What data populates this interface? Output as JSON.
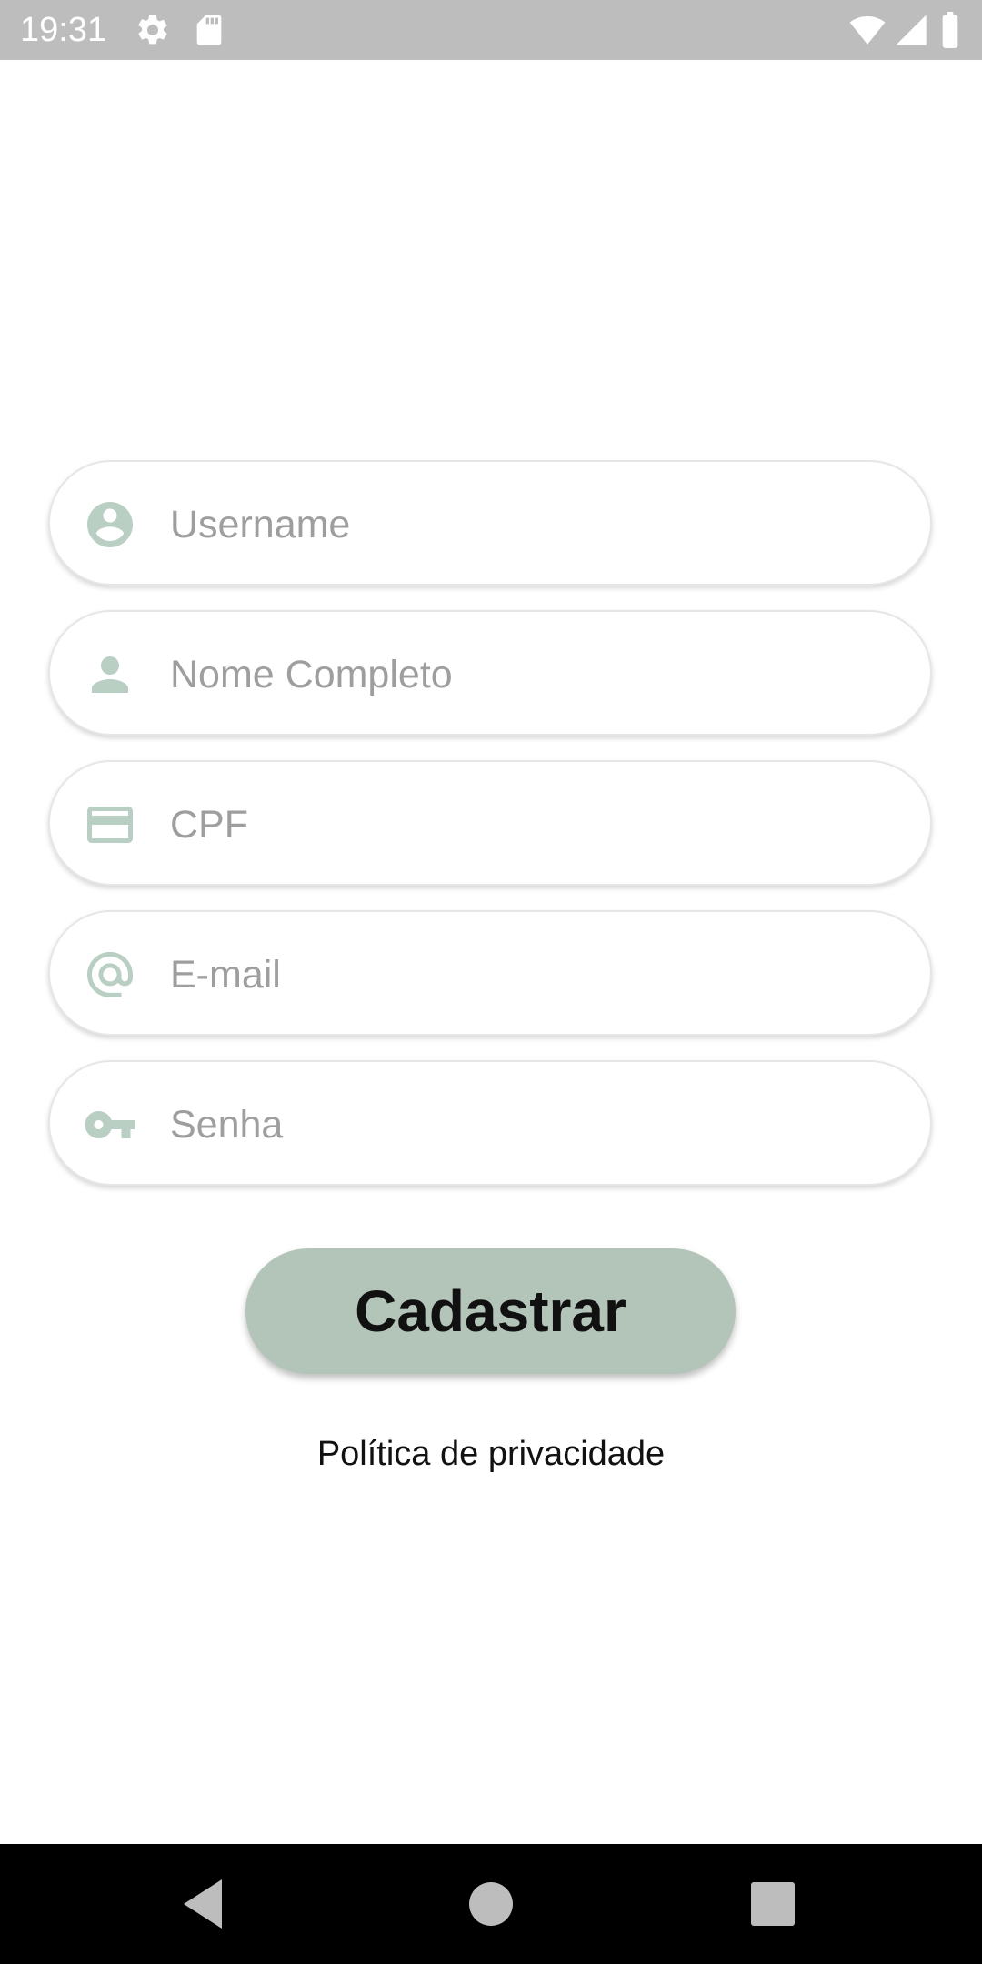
{
  "status_bar": {
    "time": "19:31",
    "icons": [
      "gear-icon",
      "sd-card-icon",
      "wifi-icon",
      "signal-icon",
      "battery-icon"
    ]
  },
  "form": {
    "fields": [
      {
        "name": "username",
        "icon": "account-circle-icon",
        "placeholder": "Username",
        "value": ""
      },
      {
        "name": "full-name",
        "icon": "person-icon",
        "placeholder": "Nome Completo",
        "value": ""
      },
      {
        "name": "cpf",
        "icon": "credit-card-icon",
        "placeholder": "CPF",
        "value": ""
      },
      {
        "name": "email",
        "icon": "at-sign-icon",
        "placeholder": "E-mail",
        "value": ""
      },
      {
        "name": "password",
        "icon": "key-icon",
        "placeholder": "Senha",
        "value": ""
      }
    ],
    "submit_label": "Cadastrar",
    "privacy_label": "Política de privacidade"
  },
  "nav_bar": {
    "buttons": [
      "back-icon",
      "home-icon",
      "recents-icon"
    ]
  },
  "colors": {
    "status_bar": "#bdbdbd",
    "icon_tint": "#b9cfc3",
    "button": "#b3c4b9",
    "nav_bar": "#000000"
  }
}
